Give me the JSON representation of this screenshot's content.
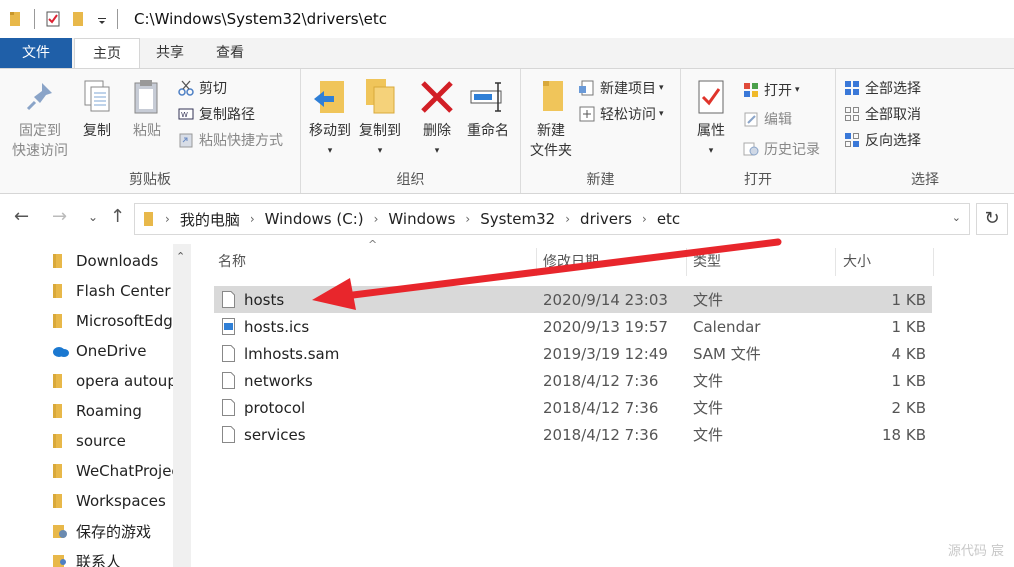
{
  "titlebar": {
    "path": "C:\\Windows\\System32\\drivers\\etc"
  },
  "tabs": [
    "文件",
    "主页",
    "共享",
    "查看"
  ],
  "ribbon": {
    "groups": {
      "clipboard": "剪贴板",
      "organize": "组织",
      "new": "新建",
      "open": "打开",
      "select": "选择"
    },
    "pin_line1": "固定到",
    "pin_line2": "快速访问",
    "copy": "复制",
    "paste": "粘贴",
    "cut": "剪切",
    "copy_path": "复制路径",
    "paste_shortcut": "粘贴快捷方式",
    "move_to": "移动到",
    "copy_to": "复制到",
    "delete": "删除",
    "rename": "重命名",
    "new_folder_line1": "新建",
    "new_folder_line2": "文件夹",
    "new_item": "新建项目",
    "easy_access": "轻松访问",
    "properties": "属性",
    "open": "打开",
    "edit": "编辑",
    "history": "历史记录",
    "select_all": "全部选择",
    "select_none": "全部取消",
    "invert_select": "反向选择"
  },
  "breadcrumb": [
    "我的电脑",
    "Windows (C:)",
    "Windows",
    "System32",
    "drivers",
    "etc"
  ],
  "nav_items": [
    {
      "label": "Downloads",
      "icon": "folder-icon"
    },
    {
      "label": "Flash Center",
      "icon": "folder-icon"
    },
    {
      "label": "MicrosoftEdge",
      "icon": "folder-icon"
    },
    {
      "label": "OneDrive",
      "icon": "cloud-icon"
    },
    {
      "label": "opera autoupdate",
      "icon": "folder-icon"
    },
    {
      "label": "Roaming",
      "icon": "folder-icon"
    },
    {
      "label": "source",
      "icon": "folder-icon"
    },
    {
      "label": "WeChatProjects",
      "icon": "folder-icon"
    },
    {
      "label": "Workspaces",
      "icon": "folder-icon"
    },
    {
      "label": "保存的游戏",
      "icon": "games-folder-icon"
    },
    {
      "label": "联系人",
      "icon": "contacts-folder-icon"
    }
  ],
  "columns": {
    "name": "名称",
    "date": "修改日期",
    "type": "类型",
    "size": "大小"
  },
  "files": [
    {
      "name": "hosts",
      "date": "2020/9/14 23:03",
      "type": "文件",
      "size": "1 KB",
      "selected": true
    },
    {
      "name": "hosts.ics",
      "date": "2020/9/13 19:57",
      "type": "Calendar",
      "size": "1 KB"
    },
    {
      "name": "lmhosts.sam",
      "date": "2019/3/19 12:49",
      "type": "SAM 文件",
      "size": "4 KB"
    },
    {
      "name": "networks",
      "date": "2018/4/12 7:36",
      "type": "文件",
      "size": "1 KB"
    },
    {
      "name": "protocol",
      "date": "2018/4/12 7:36",
      "type": "文件",
      "size": "2 KB"
    },
    {
      "name": "services",
      "date": "2018/4/12 7:36",
      "type": "文件",
      "size": "18 KB"
    }
  ],
  "watermark": "源代码 宸",
  "colors": {
    "file_tab": "#1f5fa8",
    "folder": "#e8b84a",
    "arrow": "#e8262c",
    "selected_row": "#d9d9d9"
  }
}
